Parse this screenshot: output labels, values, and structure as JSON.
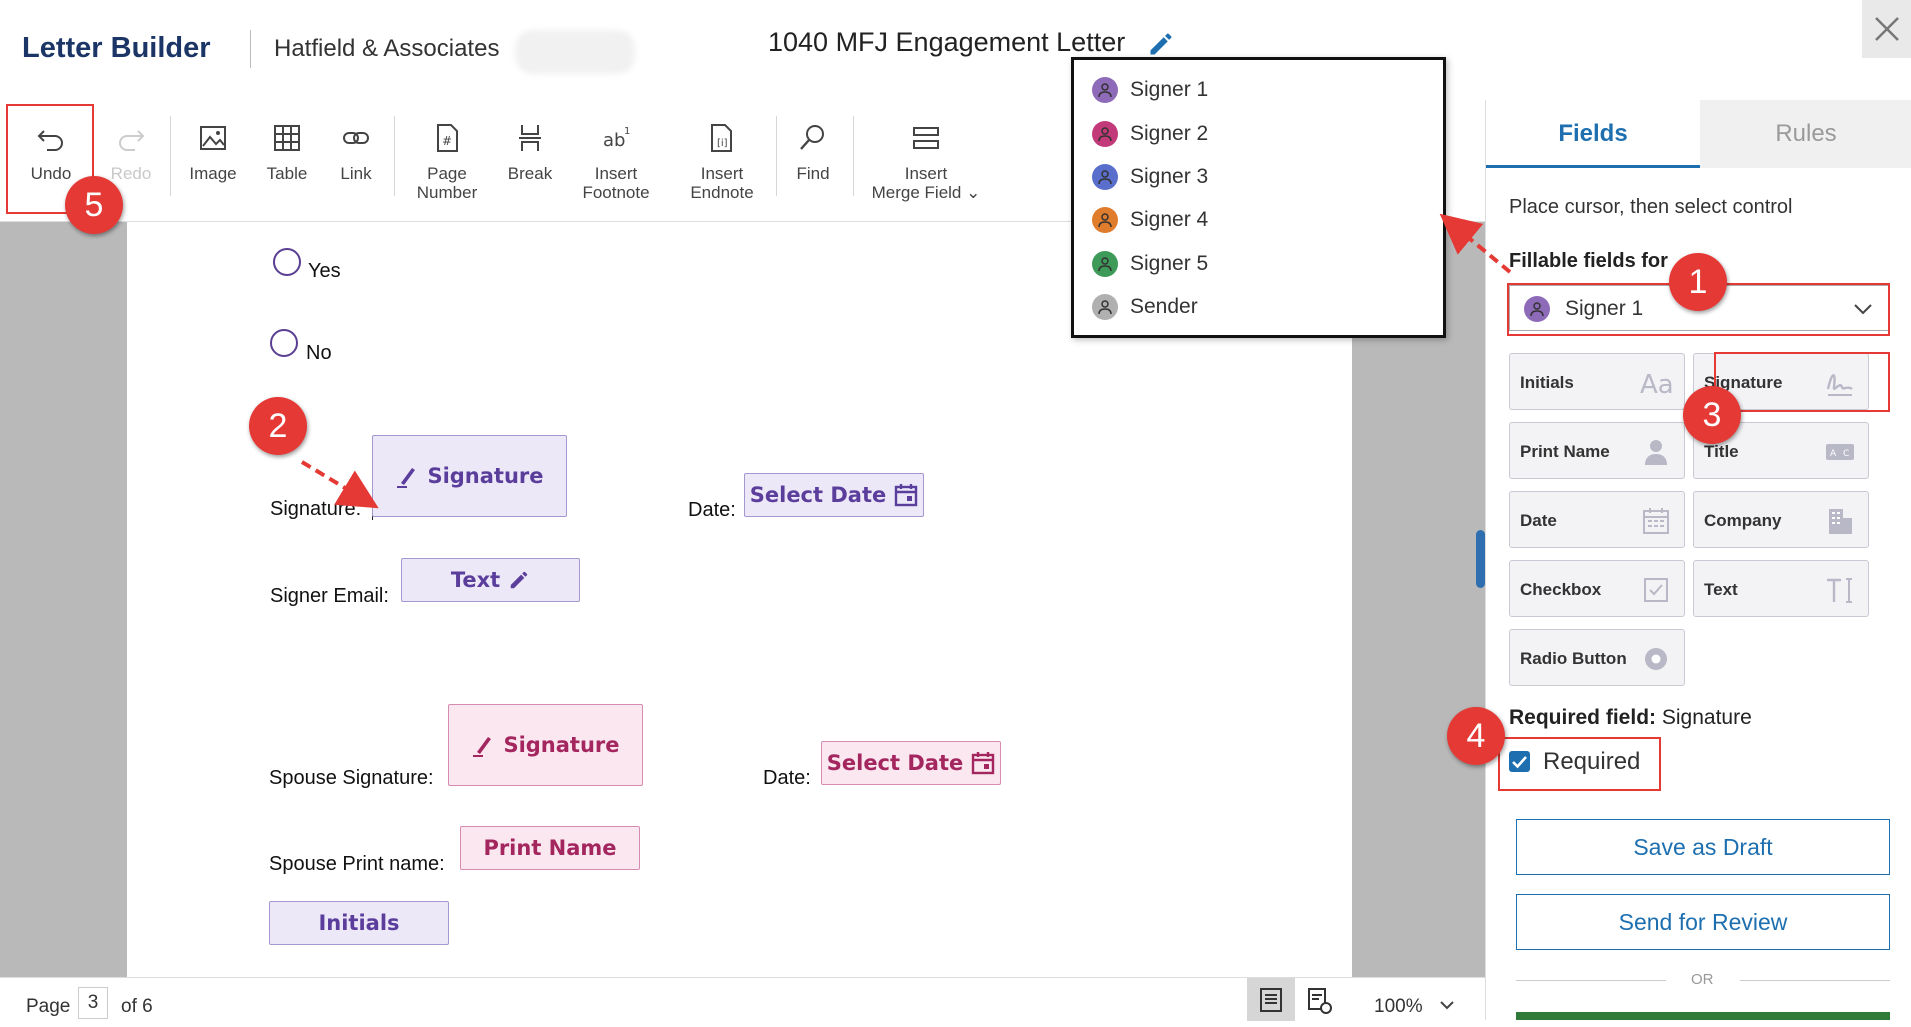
{
  "header": {
    "brand": "Letter Builder",
    "firm": "Hatfield & Associates",
    "doc_title": "1040 MFJ Engagement Letter",
    "close_icon": "close-icon",
    "edit_icon": "pencil-icon"
  },
  "toolbar": {
    "undo": "Undo",
    "redo": "Redo",
    "image": "Image",
    "table": "Table",
    "link": "Link",
    "page_number_1": "Page",
    "page_number_2": "Number",
    "break": "Break",
    "footnote_1": "Insert",
    "footnote_2": "Footnote",
    "endnote_1": "Insert",
    "endnote_2": "Endnote",
    "find": "Find",
    "merge_1": "Insert",
    "merge_2": "Merge Field ⌄"
  },
  "document": {
    "yes": "Yes",
    "no": "No",
    "signature_label": "Signature:",
    "signature_field": "Signature",
    "date_label": "Date:",
    "select_date": "Select Date",
    "signer_email_label": "Signer Email:",
    "text_field": "Text",
    "spouse_signature_label": "Spouse Signature:",
    "spouse_signature_field": "Signature",
    "spouse_date_label": "Date:",
    "spouse_select_date": "Select Date",
    "spouse_print_label": "Spouse Print name:",
    "print_name_field": "Print Name",
    "initials_field": "Initials"
  },
  "statusbar": {
    "page_label": "Page",
    "page_num": "3",
    "of": "of 6",
    "zoom": "100%"
  },
  "signer_dropdown": {
    "items": [
      {
        "label": "Signer 1",
        "color": "#8e6bb8"
      },
      {
        "label": "Signer 2",
        "color": "#c23a7a"
      },
      {
        "label": "Signer 3",
        "color": "#5a6fcc"
      },
      {
        "label": "Signer 4",
        "color": "#e07d2c"
      },
      {
        "label": "Signer 5",
        "color": "#3d9a58"
      },
      {
        "label": "Sender",
        "color": "#b0b0b0"
      }
    ]
  },
  "panel": {
    "tab_fields": "Fields",
    "tab_rules": "Rules",
    "instruction": "Place cursor, then select control",
    "fillable_label": "Fillable fields for",
    "selected_signer": "Signer 1",
    "controls": {
      "initials": "Initials",
      "signature": "Signature",
      "print_name": "Print Name",
      "title": "Title",
      "date": "Date",
      "company": "Company",
      "checkbox": "Checkbox",
      "text": "Text",
      "radio": "Radio Button"
    },
    "required_label": "Required field:",
    "required_value": "Signature",
    "required_checkbox": "Required",
    "save_draft": "Save as Draft",
    "send_review": "Send for Review",
    "or": "OR"
  },
  "annotations": {
    "b1": "1",
    "b2": "2",
    "b3": "3",
    "b4": "4",
    "b5": "5"
  },
  "colors": {
    "accent": "#1d6fb0",
    "brand": "#1b3566",
    "annotation": "#e53935",
    "field_purple": "#5b3e9c",
    "field_pink": "#a3265f"
  }
}
